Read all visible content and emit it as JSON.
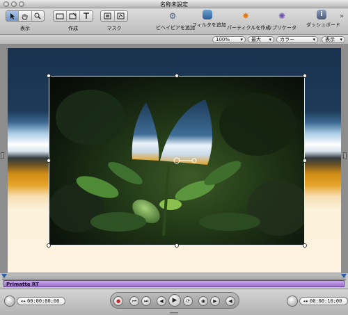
{
  "window": {
    "title": "名称未設定"
  },
  "toolbar": {
    "view_label": "表示",
    "create_label": "作成",
    "mask_label": "マスク",
    "add_behavior_label": "ビヘイビアを追加",
    "add_filter_label": "フィルタを追加",
    "make_particles_label": "パーティクルを作成",
    "replicate_label": "リプリケータ",
    "dashboard_label": "ダッシュボード",
    "overflow_glyph": "»"
  },
  "options": {
    "zoom": "100%",
    "quality": "最大",
    "channels": "カラー",
    "view": "表示"
  },
  "timeline": {
    "clip_name": "Primatte RT"
  },
  "transport": {
    "current_time": "00:00:00;00",
    "duration": "00:00:10;00"
  },
  "colors": {
    "clip_bar": "#9c6fcf",
    "selection_blue": "#6f97c8"
  }
}
